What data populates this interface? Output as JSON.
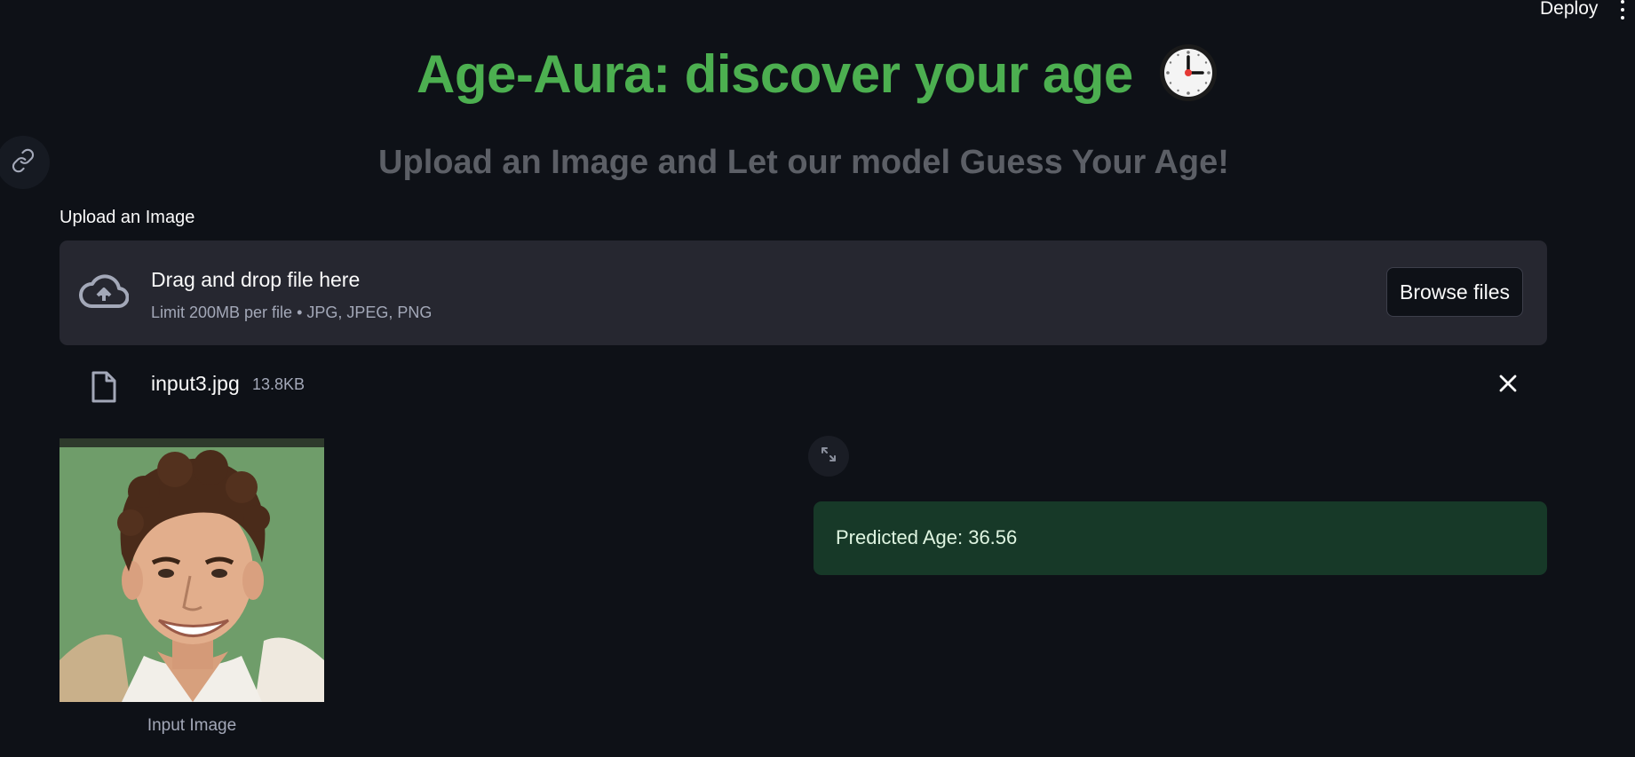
{
  "header": {
    "deploy_label": "Deploy"
  },
  "app": {
    "title": "Age-Aura: discover your age",
    "title_icon": "clock-icon",
    "subtitle": "Upload an Image and Let our model Guess Your Age!",
    "accent_color": "#4caf50"
  },
  "uploader": {
    "label": "Upload an Image",
    "drop_text": "Drag and drop file here",
    "limit_text": "Limit 200MB per file • JPG, JPEG, PNG",
    "browse_label": "Browse files"
  },
  "uploaded_file": {
    "name": "input3.jpg",
    "size": "13.8KB"
  },
  "input_image": {
    "caption": "Input Image"
  },
  "prediction": {
    "text": "Predicted Age: 36.56",
    "background_color": "#173928"
  }
}
